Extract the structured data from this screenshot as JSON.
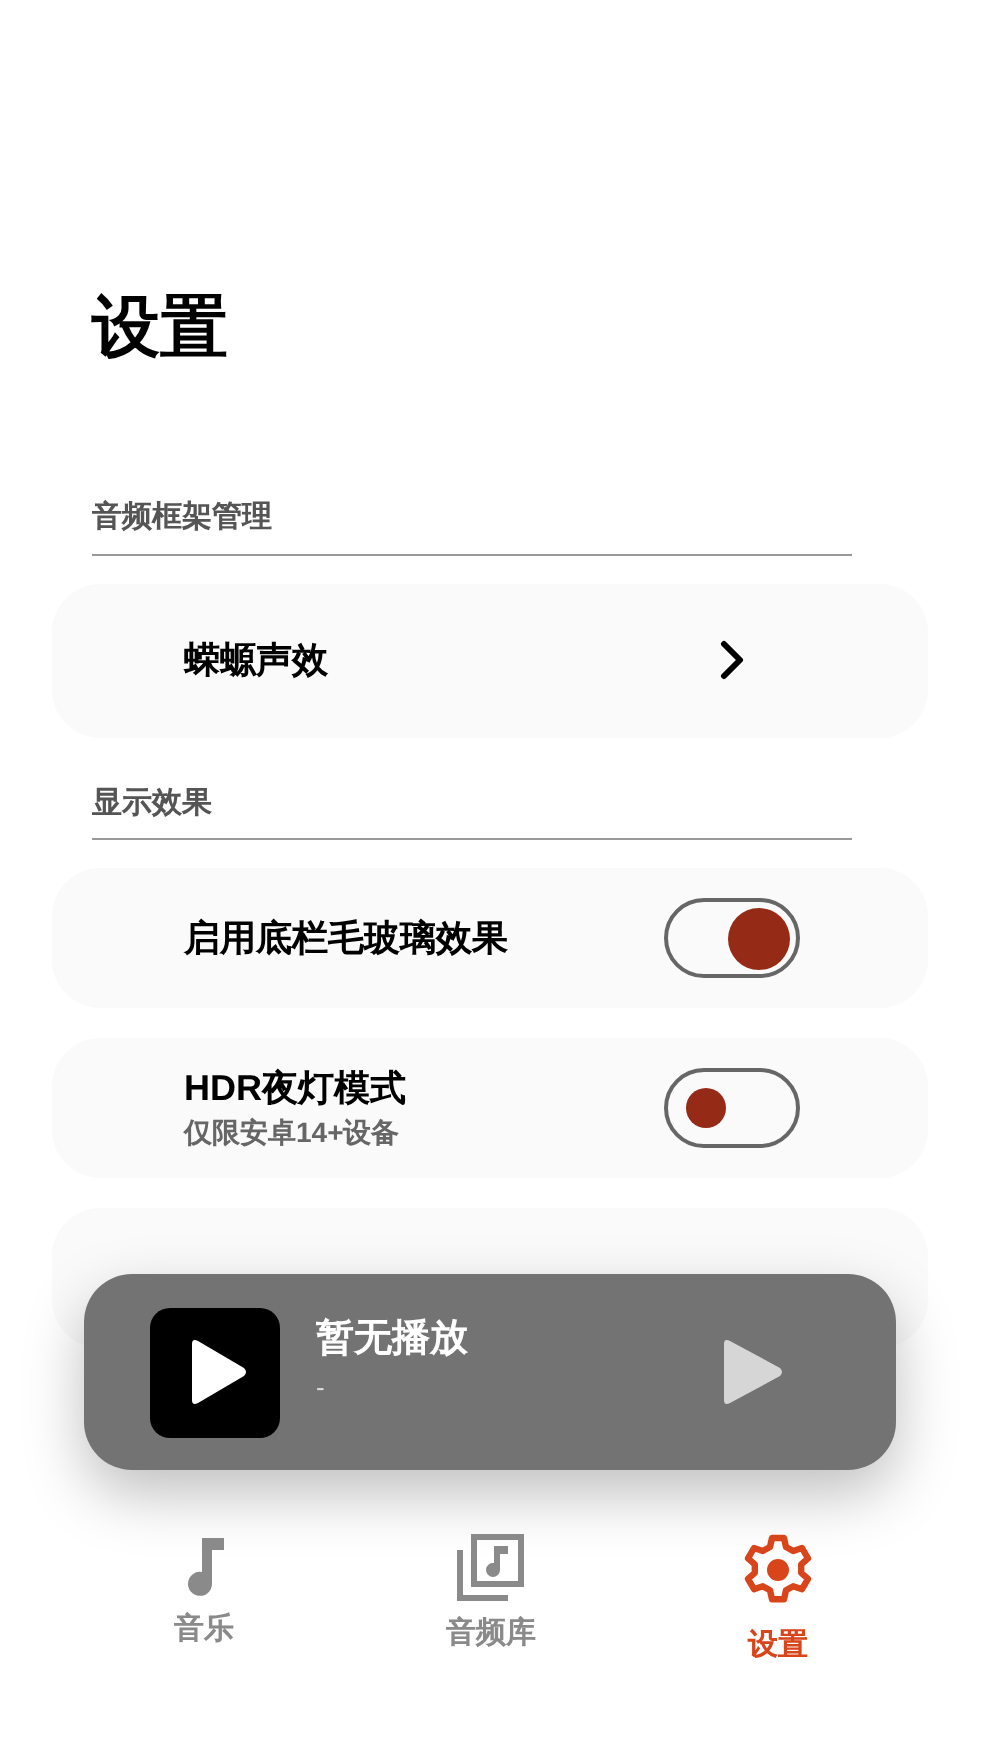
{
  "title": "设置",
  "sections": [
    {
      "header": "音频框架管理",
      "items": [
        {
          "kind": "link",
          "label": "蝾螈声效"
        }
      ]
    },
    {
      "header": "显示效果",
      "items": [
        {
          "kind": "toggle",
          "label": "启用底栏毛玻璃效果",
          "on": true
        },
        {
          "kind": "toggle",
          "label": "HDR夜灯模式",
          "subtitle": "仅限安卓14+设备",
          "on": false
        }
      ]
    }
  ],
  "player": {
    "title": "暂无播放",
    "subtitle": "-"
  },
  "nav": [
    {
      "label": "音乐",
      "kind": "note",
      "selected": false
    },
    {
      "label": "音频库",
      "kind": "library",
      "selected": false
    },
    {
      "label": "设置",
      "kind": "gear",
      "selected": true
    }
  ]
}
